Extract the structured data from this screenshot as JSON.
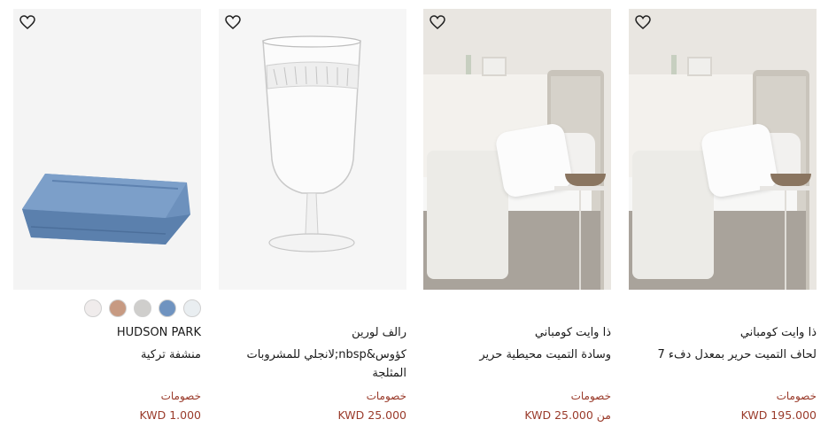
{
  "products": [
    {
      "brand": "HUDSON PARK",
      "name": "منشفة تركية",
      "discount_label": "خصومات",
      "price": "KWD 1.000",
      "colors": [
        "#f0ecec",
        "#c79a82",
        "#cfcecc",
        "#6f93c0",
        "#e9eef1"
      ],
      "image_kind": "towel"
    },
    {
      "brand": "رالف لورين",
      "name": "كؤوس&nbsp;لانجلي للمشروبات المثلجة",
      "discount_label": "خصومات",
      "price": "KWD 25.000",
      "image_kind": "glass"
    },
    {
      "brand": "ذا وايت كومباني",
      "name": "وسادة التميت محيطية حرير",
      "discount_label": "خصومات",
      "price": "من KWD 25.000",
      "image_kind": "bedroom"
    },
    {
      "brand": "ذا وايت كومباني",
      "name": "لحاف التميت حرير بمعدل دفء 7",
      "discount_label": "خصومات",
      "price": "KWD 195.000",
      "image_kind": "bedroom"
    }
  ],
  "icons": {
    "wishlist": "heart-outline-icon"
  }
}
